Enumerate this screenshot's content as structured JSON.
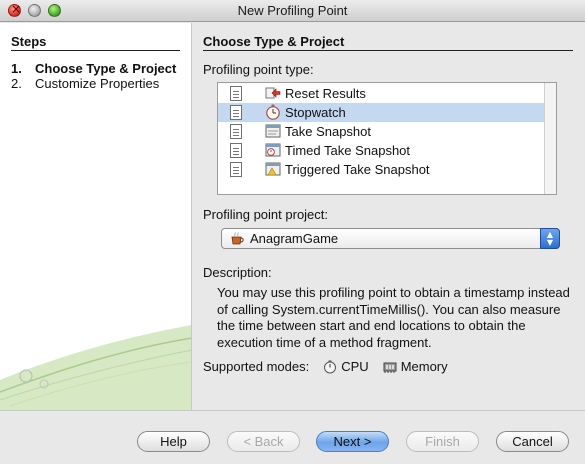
{
  "window": {
    "title": "New Profiling Point"
  },
  "steps": {
    "heading": "Steps",
    "items": [
      {
        "num": "1.",
        "label": "Choose Type & Project",
        "active": true
      },
      {
        "num": "2.",
        "label": "Customize Properties",
        "active": false
      }
    ]
  },
  "main": {
    "heading": "Choose Type & Project",
    "type_label": "Profiling point type:",
    "types": [
      {
        "label": "Reset Results",
        "icon": "reset-results-icon",
        "selected": false
      },
      {
        "label": "Stopwatch",
        "icon": "stopwatch-icon",
        "selected": true
      },
      {
        "label": "Take Snapshot",
        "icon": "take-snapshot-icon",
        "selected": false
      },
      {
        "label": "Timed Take Snapshot",
        "icon": "timed-snapshot-icon",
        "selected": false
      },
      {
        "label": "Triggered Take Snapshot",
        "icon": "triggered-snapshot-icon",
        "selected": false
      }
    ],
    "project_label": "Profiling point project:",
    "project_value": "AnagramGame",
    "description_label": "Description:",
    "description": "You may use this profiling point to obtain a timestamp instead of calling System.currentTimeMillis(). You can also measure the time between start and end locations to obtain the execution time of a method fragment.",
    "modes_label": "Supported modes:",
    "modes": [
      {
        "label": "CPU",
        "icon": "cpu-icon"
      },
      {
        "label": "Memory",
        "icon": "memory-icon"
      }
    ]
  },
  "buttons": {
    "help": "Help",
    "back": "< Back",
    "next": "Next >",
    "finish": "Finish",
    "cancel": "Cancel"
  },
  "colors": {
    "selection": "#c4d8f0",
    "default_button": "#6ea4ea",
    "close_button": "#d8261b"
  }
}
